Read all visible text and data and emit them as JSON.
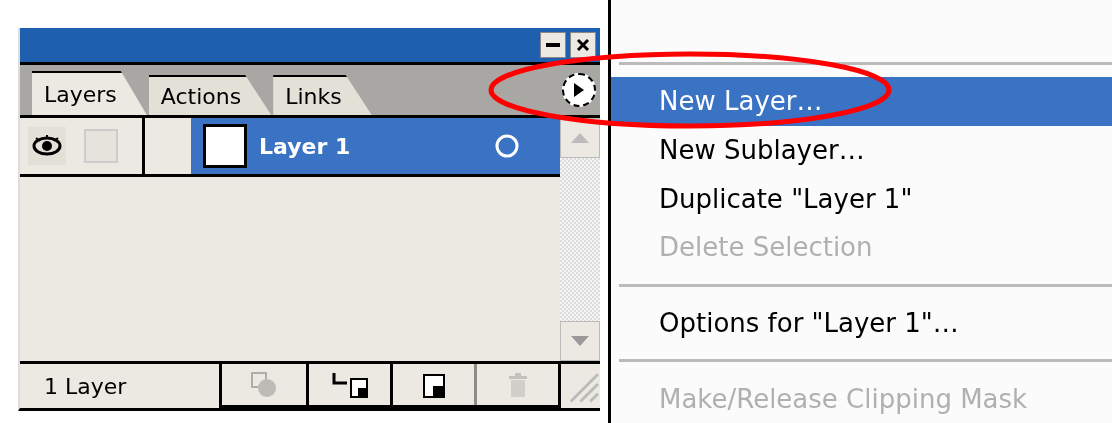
{
  "panel": {
    "tabs": [
      {
        "label": "Layers",
        "selected": true
      },
      {
        "label": "Actions",
        "selected": false
      },
      {
        "label": "Links",
        "selected": false
      }
    ],
    "layers": [
      {
        "name": "Layer 1",
        "visible": true,
        "locked": false,
        "selected": true
      }
    ],
    "status": "1 Layer",
    "footer_buttons": [
      {
        "kind": "clipping-mask",
        "disabled": true
      },
      {
        "kind": "new-sublayer",
        "disabled": false
      },
      {
        "kind": "new-layer",
        "disabled": false
      },
      {
        "kind": "delete",
        "disabled": true
      }
    ]
  },
  "menu": {
    "items": [
      {
        "kind": "separator"
      },
      {
        "kind": "item",
        "label": "New Layer…",
        "selected": true,
        "disabled": false
      },
      {
        "kind": "item",
        "label": "New Sublayer…",
        "selected": false,
        "disabled": false
      },
      {
        "kind": "item",
        "label": "Duplicate \"Layer 1\"",
        "selected": false,
        "disabled": false
      },
      {
        "kind": "item",
        "label": "Delete Selection",
        "selected": false,
        "disabled": true
      },
      {
        "kind": "separator"
      },
      {
        "kind": "item",
        "label": "Options for \"Layer 1\"…",
        "selected": false,
        "disabled": false
      },
      {
        "kind": "separator"
      },
      {
        "kind": "item",
        "label": "Make/Release Clipping Mask",
        "selected": false,
        "disabled": true
      }
    ]
  },
  "annotations": [
    {
      "kind": "ellipse",
      "color": "#ff0000"
    }
  ]
}
